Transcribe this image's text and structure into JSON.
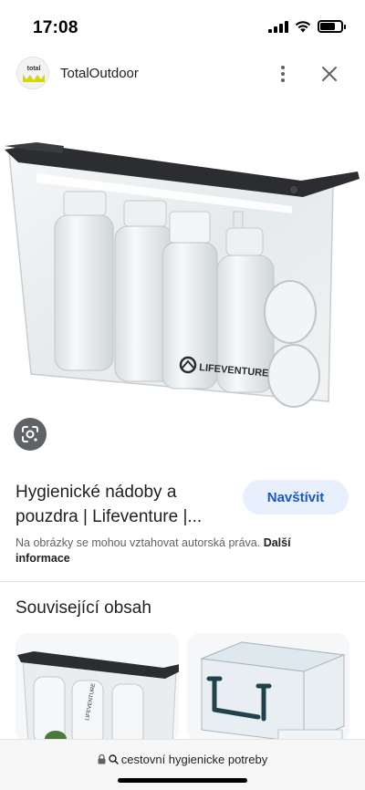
{
  "status_bar": {
    "time": "17:08"
  },
  "header": {
    "site_name": "TotalOutdoor",
    "logo_text": "total",
    "logo_icon": "totaloutdoor-logo-icon",
    "more_icon": "more-vert-icon",
    "close_icon": "close-icon"
  },
  "main_image": {
    "brand_text": "LIFEVENTURE",
    "lens_icon": "google-lens-icon"
  },
  "result": {
    "title": "Hygienické nádoby a pouzdra | Lifeventure |...",
    "visit_label": "Navštívit",
    "copyright_text": "Na obrázky se mohou vztahovat autorská práva.",
    "more_info_label": "Další informace"
  },
  "related": {
    "heading": "Související obsah",
    "cards": [
      {
        "kind": "toiletry-pouch-thumbnail",
        "brand_text": "LIFEVENTURE"
      },
      {
        "kind": "plastic-box-thumbnail"
      }
    ]
  },
  "url_bar": {
    "text": "cestovní hygienicke potreby",
    "lock_icon": "lock-icon",
    "search_icon": "search-icon"
  },
  "colors": {
    "accent_blue": "#1a57c9",
    "visit_bg": "#e8f0fe",
    "logo_yellow": "#d8d800",
    "secondary_text": "#5f6368"
  }
}
